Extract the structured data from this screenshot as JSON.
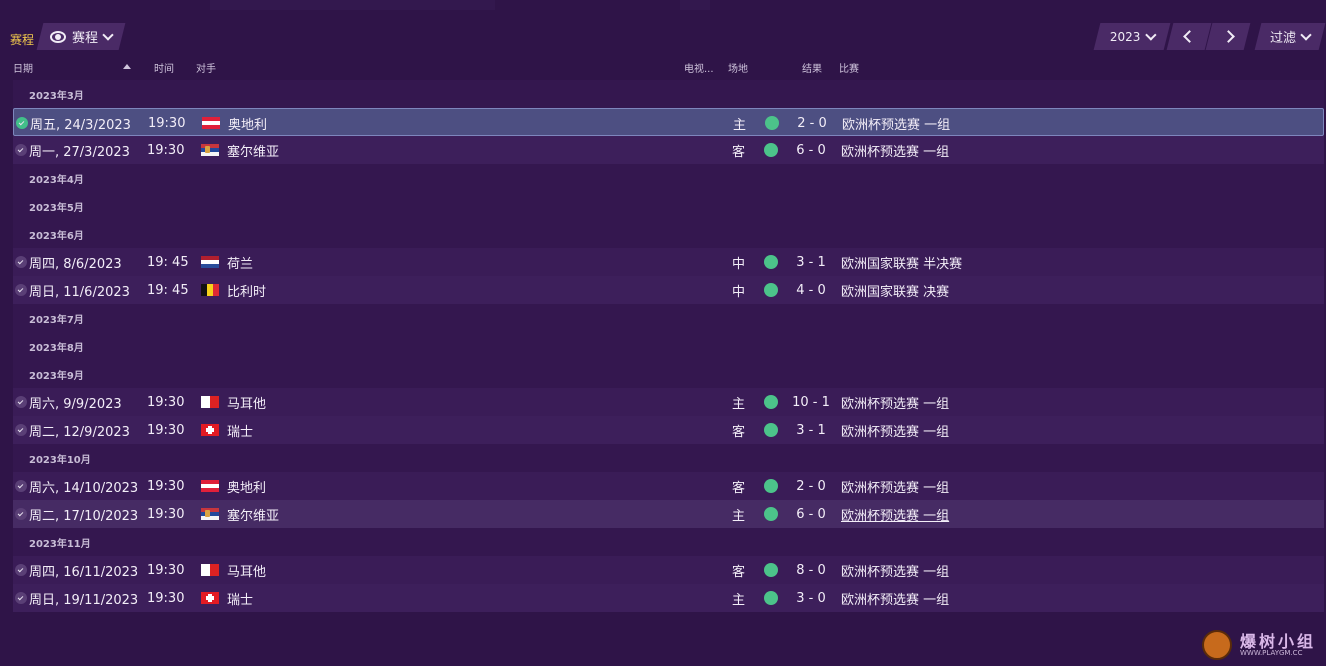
{
  "breadcrumb": "赛程",
  "view_dropdown": {
    "label": "赛程",
    "icon": "eye-icon"
  },
  "year_dropdown": {
    "value": "2023"
  },
  "filter_button": {
    "label": "过滤"
  },
  "columns": {
    "date": "日期",
    "time": "时间",
    "opponent": "对手",
    "tv": "电视...",
    "venue": "场地",
    "result": "结果",
    "competition": "比赛"
  },
  "months": {
    "mar": "2023年3月",
    "apr": "2023年4月",
    "may": "2023年5月",
    "jun": "2023年6月",
    "jul": "2023年7月",
    "aug": "2023年8月",
    "sep": "2023年9月",
    "oct": "2023年10月",
    "nov": "2023年11月"
  },
  "matches": [
    {
      "date": "周五, 24/3/2023",
      "time": "19:30",
      "opponent": "奥地利",
      "flag": "austria",
      "venue": "主",
      "result": "2 - 0",
      "competition": "欧洲杯预选赛 一组"
    },
    {
      "date": "周一, 27/3/2023",
      "time": "19:30",
      "opponent": "塞尔维亚",
      "flag": "serbia",
      "venue": "客",
      "result": "6 - 0",
      "competition": "欧洲杯预选赛 一组"
    },
    {
      "date": "周四, 8/6/2023",
      "time": "19: 45",
      "opponent": "荷兰",
      "flag": "netherlands",
      "venue": "中",
      "result": "3 - 1",
      "competition": "欧洲国家联赛 半决赛"
    },
    {
      "date": "周日, 11/6/2023",
      "time": "19: 45",
      "opponent": "比利时",
      "flag": "belgium",
      "venue": "中",
      "result": "4 - 0",
      "competition": "欧洲国家联赛 决赛"
    },
    {
      "date": "周六, 9/9/2023",
      "time": "19:30",
      "opponent": "马耳他",
      "flag": "malta",
      "venue": "主",
      "result": "10 - 1",
      "competition": "欧洲杯预选赛 一组"
    },
    {
      "date": "周二, 12/9/2023",
      "time": "19:30",
      "opponent": "瑞士",
      "flag": "switzerland",
      "venue": "客",
      "result": "3 - 1",
      "competition": "欧洲杯预选赛 一组"
    },
    {
      "date": "周六, 14/10/2023",
      "time": "19:30",
      "opponent": "奥地利",
      "flag": "austria",
      "venue": "客",
      "result": "2 - 0",
      "competition": "欧洲杯预选赛 一组"
    },
    {
      "date": "周二, 17/10/2023",
      "time": "19:30",
      "opponent": "塞尔维亚",
      "flag": "serbia",
      "venue": "主",
      "result": "6 - 0",
      "competition": "欧洲杯预选赛 一组"
    },
    {
      "date": "周四, 16/11/2023",
      "time": "19:30",
      "opponent": "马耳他",
      "flag": "malta",
      "venue": "客",
      "result": "8 - 0",
      "competition": "欧洲杯预选赛 一组"
    },
    {
      "date": "周日, 19/11/2023",
      "time": "19:30",
      "opponent": "瑞士",
      "flag": "switzerland",
      "venue": "主",
      "result": "3 - 0",
      "competition": "欧洲杯预选赛 一组"
    }
  ],
  "colors": {
    "background": "#2f1448",
    "win_dot": "#4cc38a",
    "breadcrumb": "#f2c94c",
    "selected_row": "#4d4f82"
  },
  "watermark": {
    "title": "爆树小组",
    "sub": "WWW.PLAYGM.CC"
  }
}
